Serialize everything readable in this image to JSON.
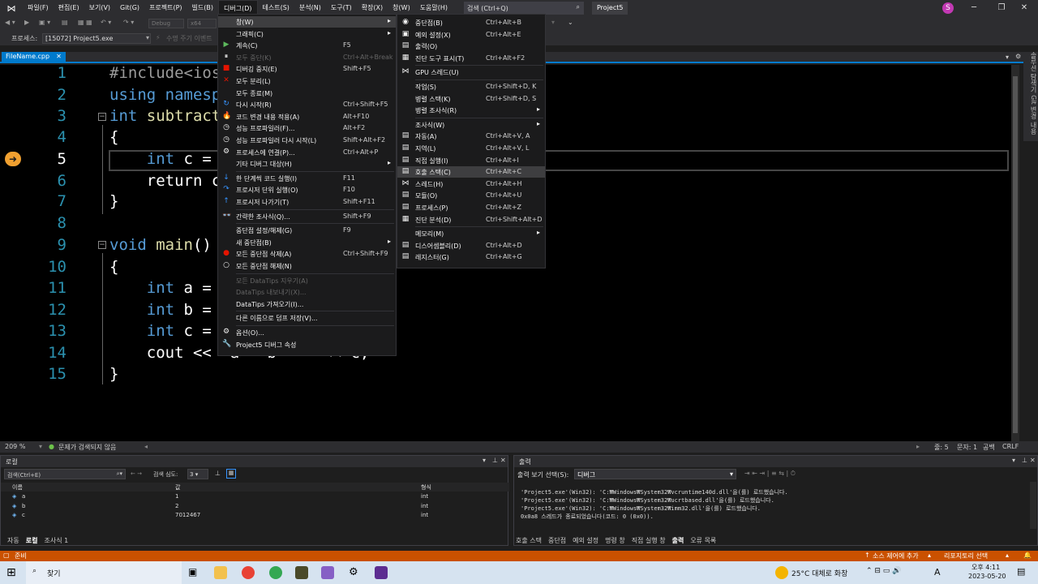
{
  "menubar": {
    "items": [
      "파일(F)",
      "편집(E)",
      "보기(V)",
      "Git(G)",
      "프로젝트(P)",
      "빌드(B)",
      "디버그(D)",
      "테스트(S)",
      "분석(N)",
      "도구(T)",
      "확장(X)",
      "창(W)",
      "도움말(H)"
    ],
    "search": "검색 (Ctrl+Q)",
    "project": "Project5",
    "avatar": "S"
  },
  "toolbar": {
    "config": "Debug",
    "platform": "x64",
    "lifecycle": "수명 주기 이벤트"
  },
  "procbar": {
    "label": "프로세스:",
    "value": "[15072] Project5.exe"
  },
  "editor": {
    "tab": "FileName.cpp",
    "tab_close": "✕",
    "lines": [
      "1",
      "2",
      "3",
      "4",
      "5",
      "6",
      "7",
      "8",
      "9",
      "10",
      "11",
      "12",
      "13",
      "14",
      "15"
    ],
    "code": {
      "l1": "#include<iost",
      "l2a": "using ",
      "l2b": "namespa",
      "l3a": "int ",
      "l3b": "subtract(",
      "l4": "{",
      "l5a": "    int ",
      "l5b": "c = a",
      "l6": "    return c;",
      "l7": "}",
      "l9a": "void ",
      "l9b": "main",
      "l9c": "()",
      "l10": "{",
      "l11a": "    int ",
      "l11b": "a = 1",
      "l12a": "    int ",
      "l12b": "b = 2",
      "l13a": "    int ",
      "l13b": "c = s",
      "l14": "    cout << \"a - b = \" << c;",
      "l15": "}"
    },
    "zoom": "209 %",
    "issues": "문제가 검색되지 않음",
    "line_info": "줄: 5",
    "char_info": "문자: 1",
    "space": "공백",
    "eol": "CRLF"
  },
  "right_panel": "솔루션 탐색기   Git 변경 내용",
  "debug_menu": [
    {
      "icon": "",
      "label": "창(W)",
      "shortcut": "",
      "sub": true,
      "hl": true
    },
    {
      "icon": "",
      "label": "그래픽(C)",
      "shortcut": "",
      "sub": true
    },
    {
      "icon": "▶",
      "label": "계속(C)",
      "shortcut": "F5",
      "color": "#5cb85c"
    },
    {
      "icon": "⏸",
      "label": "모두 중단(K)",
      "shortcut": "Ctrl+Alt+Break",
      "dis": true
    },
    {
      "icon": "■",
      "label": "디버깅 중지(E)",
      "shortcut": "Shift+F5",
      "color": "#e51400"
    },
    {
      "icon": "✕",
      "label": "모두 분리(L)",
      "shortcut": "",
      "color": "#e51400"
    },
    {
      "icon": "",
      "label": "모두 종료(M)",
      "shortcut": ""
    },
    {
      "icon": "↻",
      "label": "다시 시작(R)",
      "shortcut": "Ctrl+Shift+F5",
      "color": "#3794ff"
    },
    {
      "icon": "🔥",
      "label": "코드 변경 내용 적용(A)",
      "shortcut": "Alt+F10"
    },
    {
      "icon": "◷",
      "label": "성능 프로파일러(F)...",
      "shortcut": "Alt+F2"
    },
    {
      "icon": "◷",
      "label": "성능 프로파일러 다시 시작(L)",
      "shortcut": "Shift+Alt+F2"
    },
    {
      "icon": "⚙",
      "label": "프로세스에 연결(P)...",
      "shortcut": "Ctrl+Alt+P"
    },
    {
      "icon": "",
      "label": "기타 디버그 대상(H)",
      "shortcut": "",
      "sub": true
    },
    {
      "icon": "↓",
      "label": "한 단계씩 코드 실행(I)",
      "shortcut": "F11",
      "color": "#3794ff",
      "sep": true
    },
    {
      "icon": "↷",
      "label": "프로시저 단위 실행(O)",
      "shortcut": "F10",
      "color": "#3794ff"
    },
    {
      "icon": "↑",
      "label": "프로시저 나가기(T)",
      "shortcut": "Shift+F11",
      "color": "#3794ff"
    },
    {
      "icon": "👓",
      "label": "간략한 조사식(Q)...",
      "shortcut": "Shift+F9",
      "sep": true
    },
    {
      "icon": "",
      "label": "중단점 설정/해제(G)",
      "shortcut": "F9",
      "sep": true
    },
    {
      "icon": "",
      "label": "새 중단점(B)",
      "shortcut": "",
      "sub": true
    },
    {
      "icon": "●",
      "label": "모든 중단점 삭제(A)",
      "shortcut": "Ctrl+Shift+F9",
      "color": "#e51400"
    },
    {
      "icon": "○",
      "label": "모든 중단점 해제(N)",
      "shortcut": ""
    },
    {
      "icon": "",
      "label": "모든 DataTips 지우기(A)",
      "shortcut": "",
      "dis": true,
      "sep": true
    },
    {
      "icon": "",
      "label": "DataTips 내보내기(X)...",
      "shortcut": "",
      "dis": true
    },
    {
      "icon": "",
      "label": "DataTips 가져오기(I)...",
      "shortcut": ""
    },
    {
      "icon": "",
      "label": "다른 이름으로 덤프 저장(V)...",
      "shortcut": "",
      "sep": true
    },
    {
      "icon": "⚙",
      "label": "옵션(O)...",
      "shortcut": "",
      "sep": true
    },
    {
      "icon": "🔧",
      "label": "Project5 디버그 속성",
      "shortcut": ""
    }
  ],
  "window_submenu": [
    {
      "icon": "◉",
      "label": "중단점(B)",
      "shortcut": "Ctrl+Alt+B"
    },
    {
      "icon": "▣",
      "label": "예외 설정(X)",
      "shortcut": "Ctrl+Alt+E"
    },
    {
      "icon": "▤",
      "label": "출력(O)",
      "shortcut": ""
    },
    {
      "icon": "▦",
      "label": "진단 도구 표시(T)",
      "shortcut": "Ctrl+Alt+F2"
    },
    {
      "icon": "⋈",
      "label": "GPU 스레드(U)",
      "shortcut": "",
      "sep": true
    },
    {
      "icon": "",
      "label": "작업(S)",
      "shortcut": "Ctrl+Shift+D, K",
      "sep": true
    },
    {
      "icon": "",
      "label": "병렬 스택(K)",
      "shortcut": "Ctrl+Shift+D, S"
    },
    {
      "icon": "",
      "label": "병렬 조사식(R)",
      "shortcut": "",
      "sub": true
    },
    {
      "icon": "",
      "label": "조사식(W)",
      "shortcut": "",
      "sub": true,
      "sep": true
    },
    {
      "icon": "▤",
      "label": "자동(A)",
      "shortcut": "Ctrl+Alt+V, A"
    },
    {
      "icon": "▤",
      "label": "지역(L)",
      "shortcut": "Ctrl+Alt+V, L"
    },
    {
      "icon": "▤",
      "label": "직접 실행(I)",
      "shortcut": "Ctrl+Alt+I"
    },
    {
      "icon": "▤",
      "label": "호출 스택(C)",
      "shortcut": "Ctrl+Alt+C",
      "hl": true
    },
    {
      "icon": "⋈",
      "label": "스레드(H)",
      "shortcut": "Ctrl+Alt+H"
    },
    {
      "icon": "▤",
      "label": "모듈(O)",
      "shortcut": "Ctrl+Alt+U"
    },
    {
      "icon": "▤",
      "label": "프로세스(P)",
      "shortcut": "Ctrl+Alt+Z"
    },
    {
      "icon": "▦",
      "label": "진단 분석(D)",
      "shortcut": "Ctrl+Shift+Alt+D"
    },
    {
      "icon": "",
      "label": "메모리(M)",
      "shortcut": "",
      "sub": true,
      "sep": true
    },
    {
      "icon": "▤",
      "label": "디스어셈블리(D)",
      "shortcut": "Ctrl+Alt+D"
    },
    {
      "icon": "▤",
      "label": "레지스터(G)",
      "shortcut": "Ctrl+Alt+G"
    }
  ],
  "locals": {
    "title": "로컬",
    "search": "검색(Ctrl+E)",
    "depth_label": "검색 심도:",
    "depth": "3",
    "headers": {
      "name": "이름",
      "value": "값",
      "type": "형식"
    },
    "rows": [
      {
        "name": "a",
        "value": "1",
        "type": "int"
      },
      {
        "name": "b",
        "value": "2",
        "type": "int"
      },
      {
        "name": "c",
        "value": "7012467",
        "type": "int"
      }
    ],
    "tabs": [
      "자동",
      "로컬",
      "조사식 1"
    ]
  },
  "output": {
    "title": "출력",
    "source_label": "출력 보기 선택(S):",
    "source": "디버그",
    "lines": [
      "'Project5.exe'(Win32): 'C:₩Windows₩System32₩vcruntime140d.dll'을(를) 로드했습니다.",
      "'Project5.exe'(Win32): 'C:₩Windows₩System32₩ucrtbased.dll'을(를) 로드했습니다.",
      "'Project5.exe'(Win32): 'C:₩Windows₩System32₩imm32.dll'을(를) 로드했습니다.",
      "0x0a8 스레드가 종료되었습니다(코드: 0 (0x0))."
    ],
    "tabs": [
      "호출 스택",
      "중단점",
      "예외 설정",
      "명령 창",
      "직접 실행 창",
      "출력",
      "오류 목록"
    ]
  },
  "status": {
    "ready": "준비",
    "source_control": "소스 제어에 추가",
    "repo": "리포지토리 선택"
  },
  "taskbar": {
    "search": "찾기",
    "weather": "25°C 대체로 화창",
    "time": "오후 4:11",
    "date": "2023-05-20",
    "ime": "A"
  }
}
